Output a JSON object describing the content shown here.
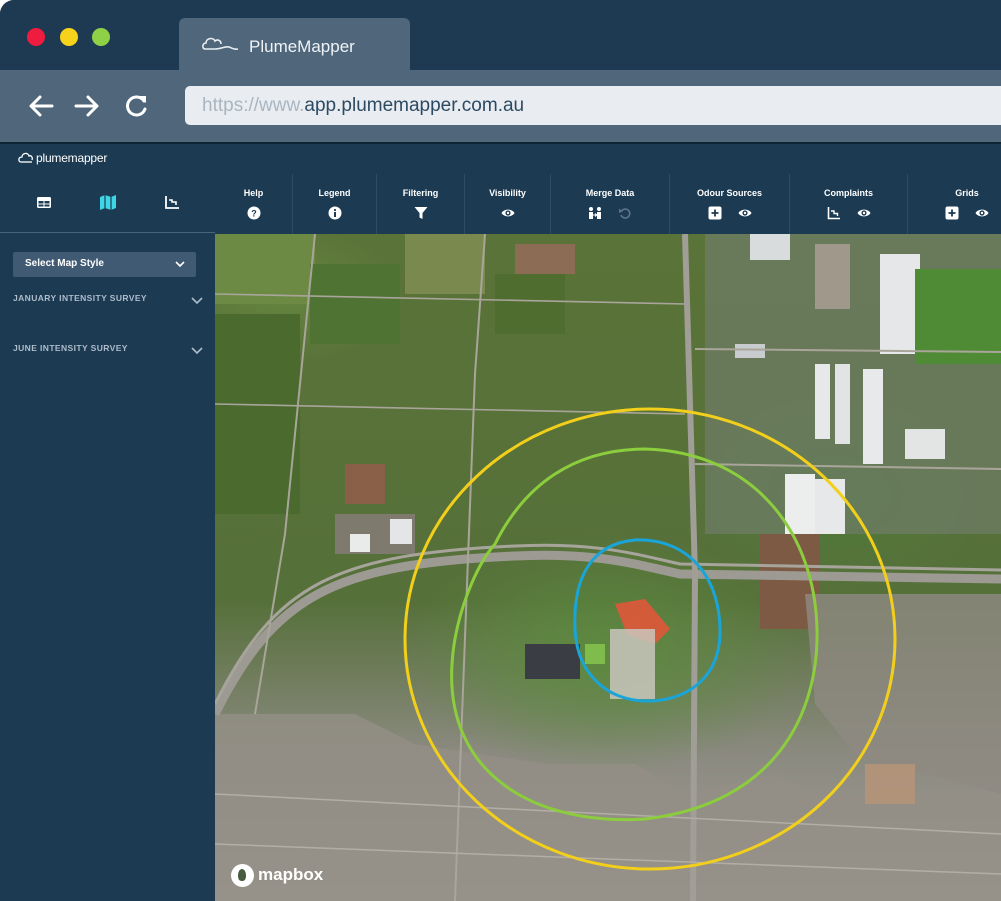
{
  "window": {
    "tab_title": "PlumeMapper",
    "url_prefix": "https://www.",
    "url_domain": "app.plumemapper.com.au"
  },
  "app": {
    "logo_text": "plumemapper"
  },
  "sidebar": {
    "tabs": [
      {
        "icon": "table-icon",
        "active": false
      },
      {
        "icon": "map-icon",
        "active": true
      },
      {
        "icon": "chart-icon",
        "active": false
      }
    ],
    "map_style_select": "Select Map Style",
    "surveys": [
      "JANUARY INTENSITY SURVEY",
      "JUNE INTENSITY SURVEY"
    ]
  },
  "toolbar": {
    "groups": [
      {
        "label": "Help",
        "icons": [
          "help-icon"
        ]
      },
      {
        "label": "Legend",
        "icons": [
          "info-icon"
        ]
      },
      {
        "label": "Filtering",
        "icons": [
          "filter-icon"
        ]
      },
      {
        "label": "Visibility",
        "icons": [
          "eye-icon"
        ]
      },
      {
        "label": "Merge Data",
        "icons": [
          "merge-icon",
          "undo-icon"
        ]
      },
      {
        "label": "Odour Sources",
        "icons": [
          "add-icon",
          "eye-icon"
        ]
      },
      {
        "label": "Complaints",
        "icons": [
          "chart-icon",
          "eye-icon"
        ]
      },
      {
        "label": "Grids",
        "icons": [
          "add-icon",
          "eye-icon"
        ]
      }
    ]
  },
  "map": {
    "attribution": "mapbox",
    "contours": [
      {
        "level": "outer",
        "color": "#f2cf1b"
      },
      {
        "level": "middle",
        "color": "#8ccd3e"
      },
      {
        "level": "inner",
        "color": "#1aa5d8"
      }
    ],
    "colors": {
      "accent": "#3fd4e6",
      "source_area": "#e8553a"
    }
  }
}
